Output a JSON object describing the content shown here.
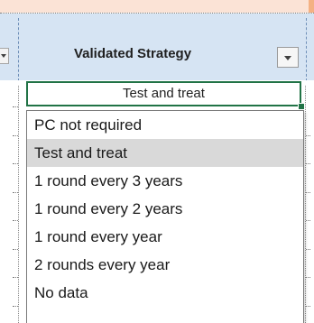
{
  "header": {
    "title": "Validated Strategy"
  },
  "cell": {
    "value": "Test and treat"
  },
  "dropdown": {
    "selected_index": 1,
    "items": [
      {
        "label": "PC not required"
      },
      {
        "label": "Test and treat"
      },
      {
        "label": "1 round every 3 years"
      },
      {
        "label": "1 round every 2 years"
      },
      {
        "label": "1 round every year"
      },
      {
        "label": "2 rounds every year"
      },
      {
        "label": "No data"
      }
    ]
  },
  "colors": {
    "header_fill": "#d6e4f3",
    "selection_border": "#217346",
    "highlight": "#d9d9d9"
  }
}
